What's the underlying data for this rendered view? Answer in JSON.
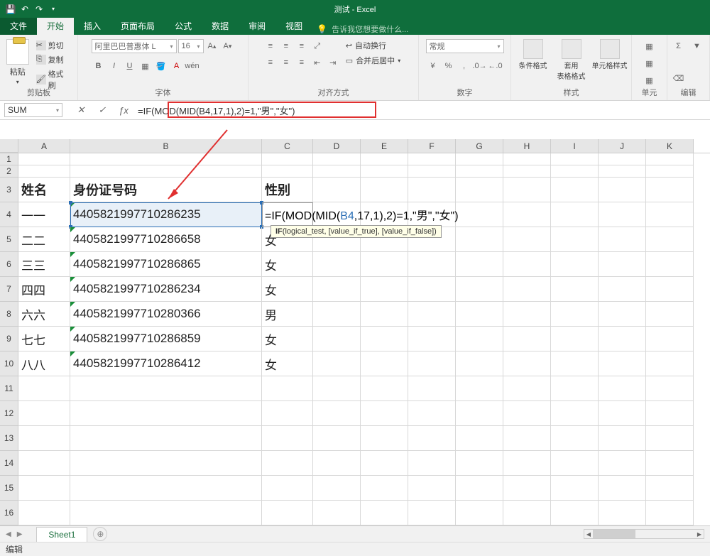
{
  "title": "测试 - Excel",
  "tabs": {
    "file": "文件",
    "home": "开始",
    "insert": "插入",
    "layout": "页面布局",
    "formulas": "公式",
    "data": "数据",
    "review": "审阅",
    "view": "视图"
  },
  "tellme": "告诉我您想要做什么...",
  "clipboard": {
    "paste": "粘贴",
    "cut": "剪切",
    "copy": "复制",
    "painter": "格式刷",
    "label": "剪贴板"
  },
  "font": {
    "name": "阿里巴巴普惠体 L",
    "size": "16",
    "label": "字体"
  },
  "align": {
    "wrap": "自动换行",
    "merge": "合并后居中",
    "label": "对齐方式"
  },
  "number": {
    "format": "常规",
    "label": "数字"
  },
  "styles": {
    "cond": "条件格式",
    "table": "套用\n表格格式",
    "cell": "单元格样式",
    "label": "样式"
  },
  "cells": {
    "label": "单元"
  },
  "edit": {
    "label": "编辑"
  },
  "namebox": "SUM",
  "fb_formula": "=IF(MOD(MID(B4,17,1),2)=1,\"男\",\"女\")",
  "columns": [
    "A",
    "B",
    "C",
    "D",
    "E",
    "F",
    "G",
    "H",
    "I",
    "J",
    "K"
  ],
  "rows_header": [
    "1",
    "2",
    "3",
    "4",
    "5",
    "6",
    "7",
    "8",
    "9",
    "10",
    "11",
    "12",
    "13",
    "14",
    "15",
    "16"
  ],
  "headers": {
    "A": "姓名",
    "B": "身份证号码",
    "C": "性别"
  },
  "table": [
    {
      "A": "一一",
      "B": "4405821997710286235",
      "C": ""
    },
    {
      "A": "二二",
      "B": "4405821997710286658",
      "C": "女"
    },
    {
      "A": "三三",
      "B": "4405821997710286865",
      "C": "女"
    },
    {
      "A": "四四",
      "B": "4405821997710286234",
      "C": "女"
    },
    {
      "A": "六六",
      "B": "4405821997710280366",
      "C": "男"
    },
    {
      "A": "七七",
      "B": "4405821997710286859",
      "C": "女"
    },
    {
      "A": "八八",
      "B": "4405821997710286412",
      "C": "女"
    }
  ],
  "c4_formula_parts": {
    "pre": "=IF(MOD(MID(",
    "ref": "B4",
    "post": ",17,1),2)=1,\"男\",\"女\")"
  },
  "tooltip": {
    "fn": "IF",
    "sig": "(logical_test, [value_if_true], [value_if_false])"
  },
  "sheet": "Sheet1",
  "status": "编辑"
}
